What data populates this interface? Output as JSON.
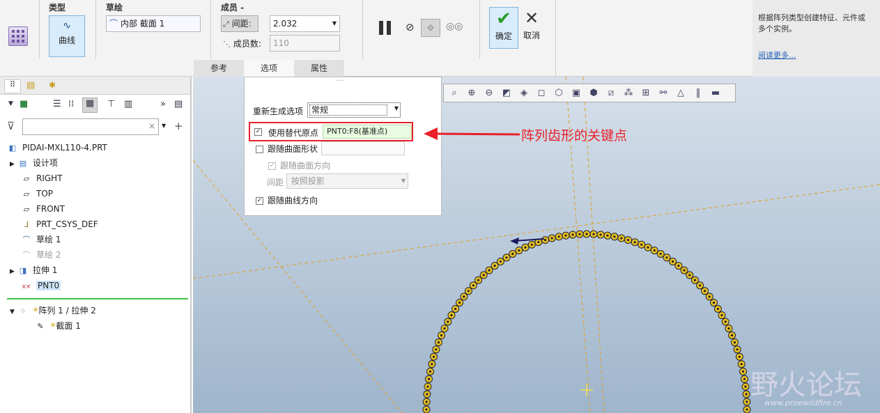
{
  "ribbon": {
    "type_group": "类型",
    "type_button": "曲线",
    "sketch_group": "草绘",
    "sketch_value": "内部 截面 1",
    "members_group": "成员 -",
    "spacing_label": "间距:",
    "spacing_value": "2.032",
    "count_label": "成员数:",
    "count_value": "110",
    "ok_label": "确定",
    "cancel_label": "取消",
    "tabs": [
      "参考",
      "选项",
      "属性"
    ]
  },
  "info_panel": {
    "text_line1": "根据阵列类型创建特征、元件或",
    "text_line2": "多个实例。",
    "link": "阅读更多..."
  },
  "model_tree": {
    "items": [
      {
        "label": "PIDAI-MXL110-4.PRT",
        "icon": "part-icon"
      },
      {
        "label": "设计项",
        "icon": "design-items-icon"
      },
      {
        "label": "RIGHT",
        "icon": "datum-plane-icon"
      },
      {
        "label": "TOP",
        "icon": "datum-plane-icon"
      },
      {
        "label": "FRONT",
        "icon": "datum-plane-icon"
      },
      {
        "label": "PRT_CSYS_DEF",
        "icon": "csys-icon"
      },
      {
        "label": "草绘 1",
        "icon": "sketch-icon"
      },
      {
        "label": "草绘 2",
        "icon": "sketch-icon"
      },
      {
        "label": "拉伸 1",
        "icon": "extrude-icon"
      },
      {
        "label": "PNT0",
        "icon": "datum-point-icon"
      },
      {
        "label": "阵列 1 / 拉伸 2",
        "icon": "pattern-icon"
      },
      {
        "label": "截面 1",
        "icon": "section-icon"
      }
    ]
  },
  "options_popup": {
    "regen_label": "重新生成选项",
    "regen_value": "常规",
    "alt_origin_label": "使用替代原点",
    "alt_origin_value": "PNT0:F8(基准点)",
    "follow_surface_shape": "跟随曲面形状",
    "follow_surface_direction": "跟随曲面方向",
    "spacing_label": "间距",
    "spacing_value": "按照投影",
    "follow_curve_direction": "跟随曲线方向"
  },
  "annotation": {
    "text": "阵列齿形的关键点",
    "color": "#e8212b"
  },
  "watermark": {
    "text": "野火论坛",
    "sub": "www.proewildfire.cn"
  },
  "colors": {
    "accent": "#7fb4e0",
    "ok_green": "#2a9a2a",
    "highlight": "#e8212b"
  }
}
